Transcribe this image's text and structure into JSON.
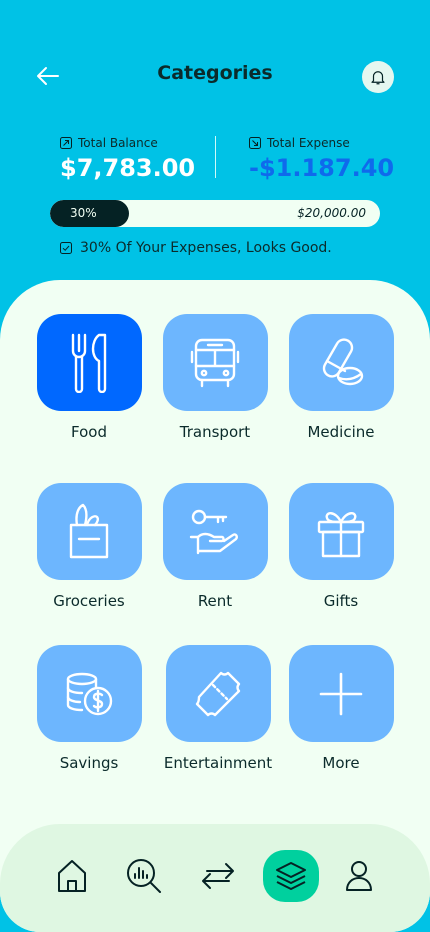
{
  "header": {
    "title": "Categories"
  },
  "balance": {
    "total_balance_label": "Total Balance",
    "total_balance_value": "$7,783.00",
    "total_expense_label": "Total Expense",
    "total_expense_value": "-$1.187.40"
  },
  "progress": {
    "percent_text": "30%",
    "target_text": "$20,000.00",
    "fraction": 0.3
  },
  "status": {
    "text": "30% Of Your Expenses, Looks Good."
  },
  "categories": [
    {
      "label": "Food",
      "icon": "fork-knife-icon",
      "active": true
    },
    {
      "label": "Transport",
      "icon": "bus-icon",
      "active": false
    },
    {
      "label": "Medicine",
      "icon": "pill-icon",
      "active": false
    },
    {
      "label": "Groceries",
      "icon": "grocery-bag-icon",
      "active": false
    },
    {
      "label": "Rent",
      "icon": "key-hand-icon",
      "active": false
    },
    {
      "label": "Gifts",
      "icon": "gift-icon",
      "active": false
    },
    {
      "label": "Savings",
      "icon": "coins-icon",
      "active": false
    },
    {
      "label": "Entertainment",
      "icon": "ticket-icon",
      "active": false
    },
    {
      "label": "More",
      "icon": "plus-icon",
      "active": false
    }
  ],
  "nav": [
    "home-icon",
    "analysis-icon",
    "transfer-icon",
    "categories-icon",
    "profile-icon"
  ],
  "colors": {
    "brand": "#00C2E6",
    "panel": "#F1FFF3",
    "tile": "#6DB6FE",
    "tile_active": "#0068FF",
    "nav_active": "#00D09E",
    "expense": "#0F6AEC"
  }
}
